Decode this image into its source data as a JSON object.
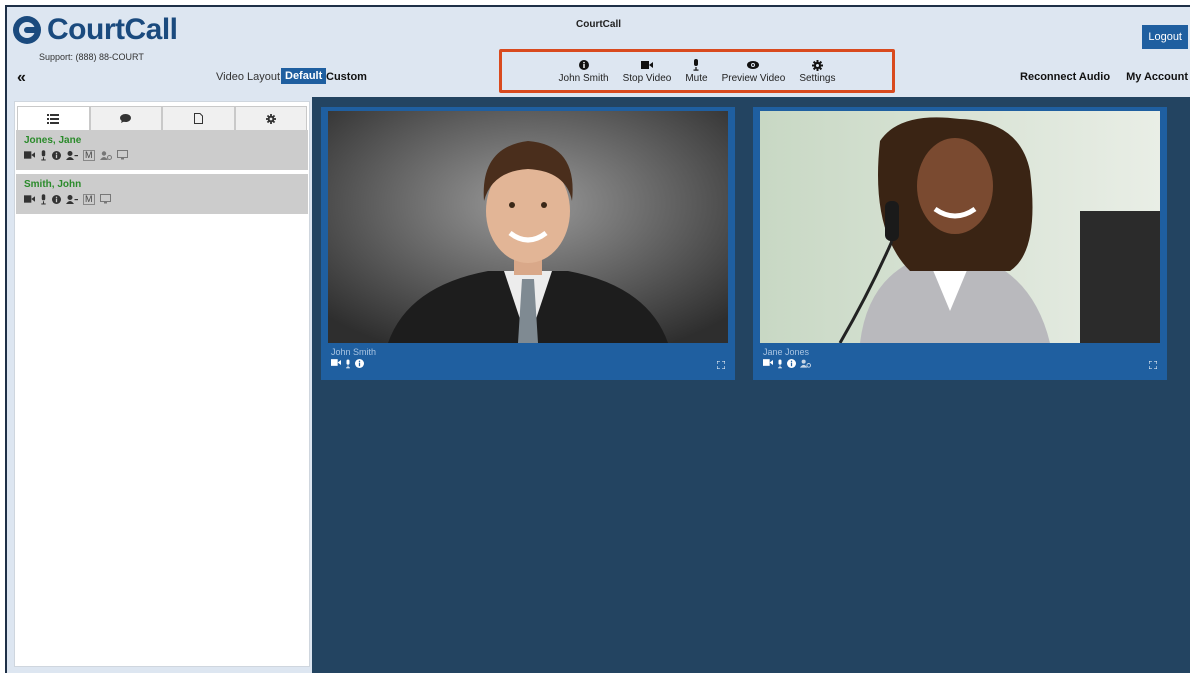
{
  "header": {
    "brand": "CourtCall",
    "support": "Support: (888) 88-COURT",
    "app_title": "CourtCall",
    "logout_label": "Logout",
    "layout_label": "Video Layout:",
    "layout_default": "Default",
    "layout_custom": "Custom",
    "reconnect_audio": "Reconnect Audio",
    "my_account": "My Account"
  },
  "toolbar": {
    "user_label": "John Smith",
    "stop_video_label": "Stop Video",
    "mute_label": "Mute",
    "preview_video_label": "Preview Video",
    "settings_label": "Settings",
    "highlight_color": "#d94a1e"
  },
  "sidebar": {
    "tabs": [
      "participants-list",
      "chat",
      "documents",
      "settings"
    ],
    "participants": [
      {
        "name": "Jones, Jane",
        "moderator_badge": "M"
      },
      {
        "name": "Smith, John",
        "moderator_badge": "M"
      }
    ]
  },
  "tiles": [
    {
      "name": "John Smith"
    },
    {
      "name": "Jane Jones"
    }
  ],
  "colors": {
    "accent": "#1f5fa0",
    "stage": "#234461",
    "participant_name": "#2a8a2a"
  }
}
